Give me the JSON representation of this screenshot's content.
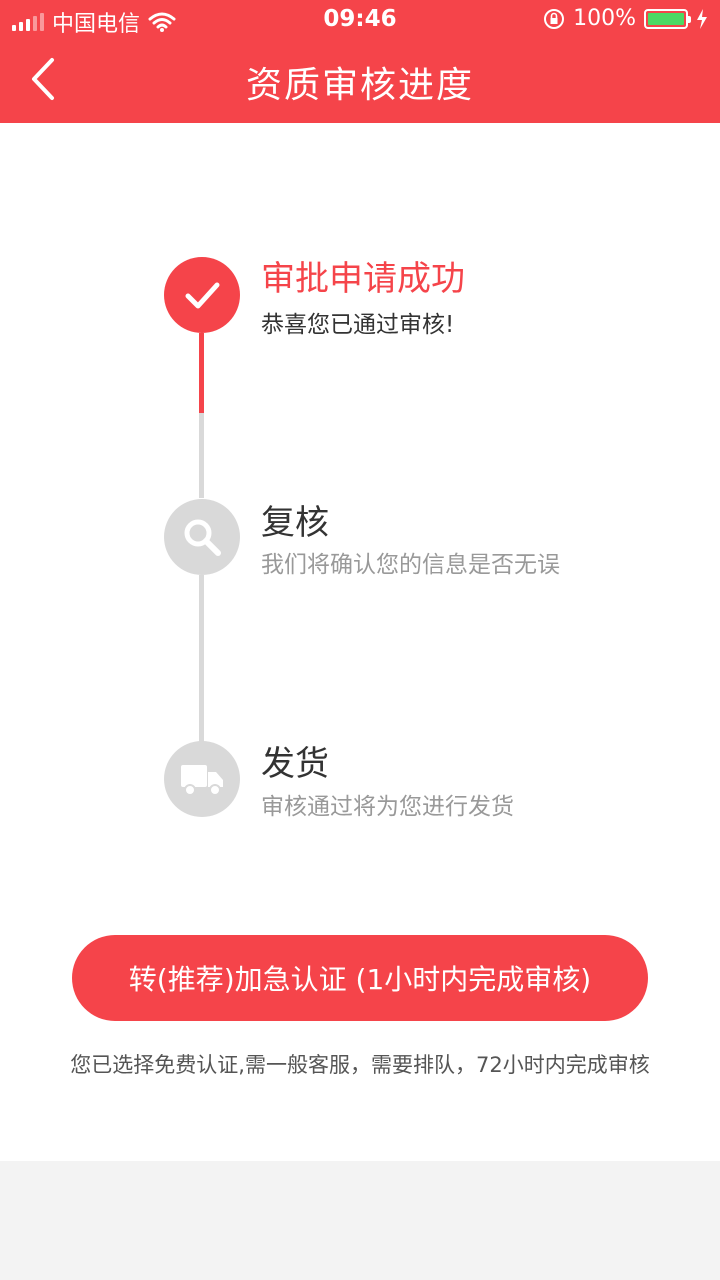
{
  "status_bar": {
    "carrier": "中国电信",
    "time": "09:46",
    "battery": "100%"
  },
  "header": {
    "title": "资质审核进度"
  },
  "steps": [
    {
      "title": "审批申请成功",
      "desc": "恭喜您已通过审核!",
      "state": "done",
      "icon": "check-icon"
    },
    {
      "title": "复核",
      "desc": "我们将确认您的信息是否无误",
      "state": "pending",
      "icon": "search-icon"
    },
    {
      "title": "发货",
      "desc": "审核通过将为您进行发货",
      "state": "pending",
      "icon": "truck-icon"
    }
  ],
  "actions": {
    "expedite_label": "转(推荐)加急认证 (1小时内完成审核)",
    "note": "您已选择免费认证,需一般客服，需要排队，72小时内完成审核"
  },
  "colors": {
    "accent": "#f5444a",
    "inactive": "#d9d9d9",
    "title_text": "#333333",
    "desc_text": "#999999"
  }
}
